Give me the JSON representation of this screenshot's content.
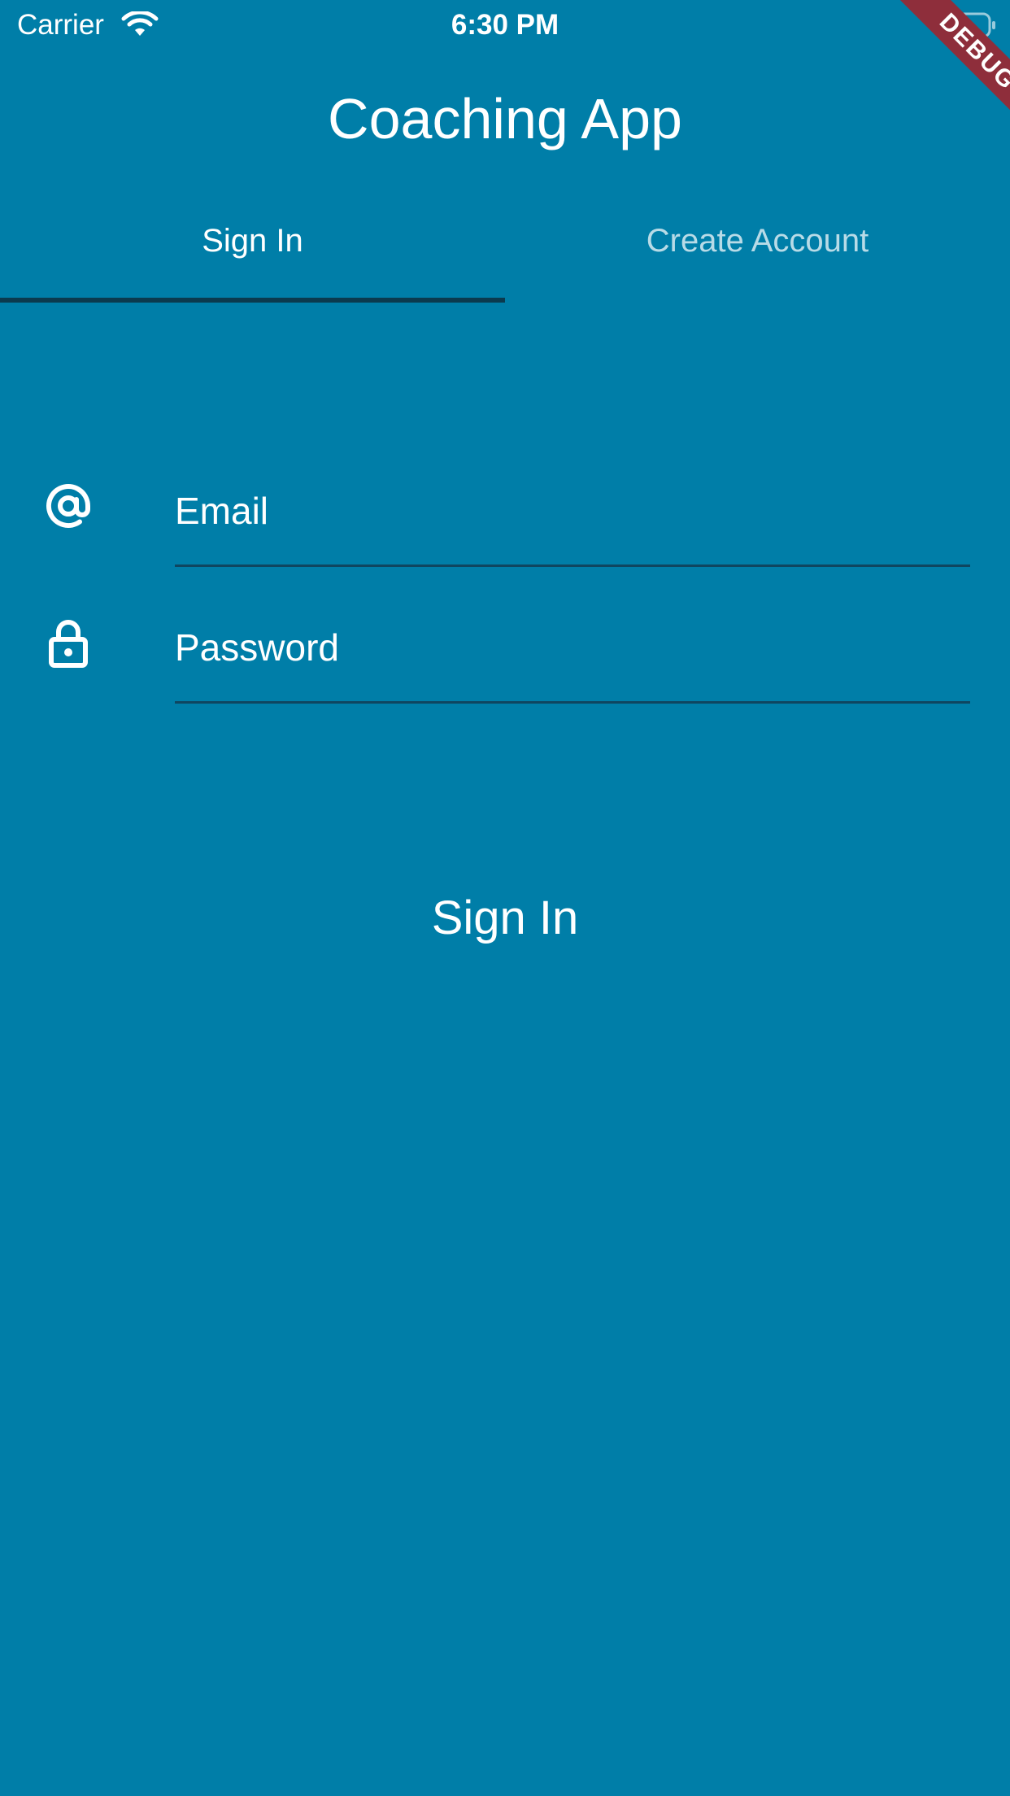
{
  "status_bar": {
    "carrier": "Carrier",
    "time": "6:30 PM",
    "icons": [
      "wifi-icon",
      "battery-icon"
    ]
  },
  "debug_banner": "DEBUG",
  "app_bar": {
    "title": "Coaching App"
  },
  "tabs": [
    {
      "label": "Sign In",
      "selected": true
    },
    {
      "label": "Create Account",
      "selected": false
    }
  ],
  "form": {
    "email": {
      "icon": "at-sign-icon",
      "placeholder": "Email",
      "value": ""
    },
    "password": {
      "icon": "lock-icon",
      "placeholder": "Password",
      "value": ""
    },
    "submit_label": "Sign In"
  },
  "colors": {
    "background": "#007EA8",
    "tab_indicator": "#0B3A4E",
    "debug_banner": "#8E2E3B",
    "text": "#FFFFFF"
  }
}
